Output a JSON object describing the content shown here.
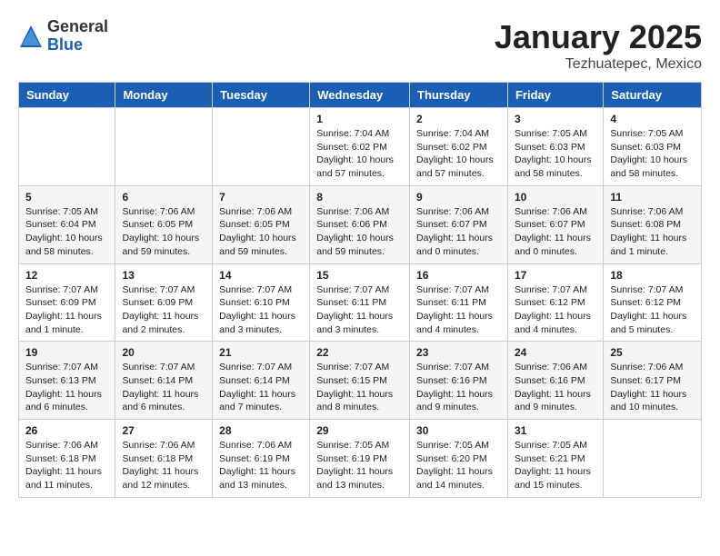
{
  "header": {
    "logo_general": "General",
    "logo_blue": "Blue",
    "month_title": "January 2025",
    "location": "Tezhuatepec, Mexico"
  },
  "weekdays": [
    "Sunday",
    "Monday",
    "Tuesday",
    "Wednesday",
    "Thursday",
    "Friday",
    "Saturday"
  ],
  "weeks": [
    [
      {
        "day": "",
        "info": ""
      },
      {
        "day": "",
        "info": ""
      },
      {
        "day": "",
        "info": ""
      },
      {
        "day": "1",
        "info": "Sunrise: 7:04 AM\nSunset: 6:02 PM\nDaylight: 10 hours\nand 57 minutes."
      },
      {
        "day": "2",
        "info": "Sunrise: 7:04 AM\nSunset: 6:02 PM\nDaylight: 10 hours\nand 57 minutes."
      },
      {
        "day": "3",
        "info": "Sunrise: 7:05 AM\nSunset: 6:03 PM\nDaylight: 10 hours\nand 58 minutes."
      },
      {
        "day": "4",
        "info": "Sunrise: 7:05 AM\nSunset: 6:03 PM\nDaylight: 10 hours\nand 58 minutes."
      }
    ],
    [
      {
        "day": "5",
        "info": "Sunrise: 7:05 AM\nSunset: 6:04 PM\nDaylight: 10 hours\nand 58 minutes."
      },
      {
        "day": "6",
        "info": "Sunrise: 7:06 AM\nSunset: 6:05 PM\nDaylight: 10 hours\nand 59 minutes."
      },
      {
        "day": "7",
        "info": "Sunrise: 7:06 AM\nSunset: 6:05 PM\nDaylight: 10 hours\nand 59 minutes."
      },
      {
        "day": "8",
        "info": "Sunrise: 7:06 AM\nSunset: 6:06 PM\nDaylight: 10 hours\nand 59 minutes."
      },
      {
        "day": "9",
        "info": "Sunrise: 7:06 AM\nSunset: 6:07 PM\nDaylight: 11 hours\nand 0 minutes."
      },
      {
        "day": "10",
        "info": "Sunrise: 7:06 AM\nSunset: 6:07 PM\nDaylight: 11 hours\nand 0 minutes."
      },
      {
        "day": "11",
        "info": "Sunrise: 7:06 AM\nSunset: 6:08 PM\nDaylight: 11 hours\nand 1 minute."
      }
    ],
    [
      {
        "day": "12",
        "info": "Sunrise: 7:07 AM\nSunset: 6:09 PM\nDaylight: 11 hours\nand 1 minute."
      },
      {
        "day": "13",
        "info": "Sunrise: 7:07 AM\nSunset: 6:09 PM\nDaylight: 11 hours\nand 2 minutes."
      },
      {
        "day": "14",
        "info": "Sunrise: 7:07 AM\nSunset: 6:10 PM\nDaylight: 11 hours\nand 3 minutes."
      },
      {
        "day": "15",
        "info": "Sunrise: 7:07 AM\nSunset: 6:11 PM\nDaylight: 11 hours\nand 3 minutes."
      },
      {
        "day": "16",
        "info": "Sunrise: 7:07 AM\nSunset: 6:11 PM\nDaylight: 11 hours\nand 4 minutes."
      },
      {
        "day": "17",
        "info": "Sunrise: 7:07 AM\nSunset: 6:12 PM\nDaylight: 11 hours\nand 4 minutes."
      },
      {
        "day": "18",
        "info": "Sunrise: 7:07 AM\nSunset: 6:12 PM\nDaylight: 11 hours\nand 5 minutes."
      }
    ],
    [
      {
        "day": "19",
        "info": "Sunrise: 7:07 AM\nSunset: 6:13 PM\nDaylight: 11 hours\nand 6 minutes."
      },
      {
        "day": "20",
        "info": "Sunrise: 7:07 AM\nSunset: 6:14 PM\nDaylight: 11 hours\nand 6 minutes."
      },
      {
        "day": "21",
        "info": "Sunrise: 7:07 AM\nSunset: 6:14 PM\nDaylight: 11 hours\nand 7 minutes."
      },
      {
        "day": "22",
        "info": "Sunrise: 7:07 AM\nSunset: 6:15 PM\nDaylight: 11 hours\nand 8 minutes."
      },
      {
        "day": "23",
        "info": "Sunrise: 7:07 AM\nSunset: 6:16 PM\nDaylight: 11 hours\nand 9 minutes."
      },
      {
        "day": "24",
        "info": "Sunrise: 7:06 AM\nSunset: 6:16 PM\nDaylight: 11 hours\nand 9 minutes."
      },
      {
        "day": "25",
        "info": "Sunrise: 7:06 AM\nSunset: 6:17 PM\nDaylight: 11 hours\nand 10 minutes."
      }
    ],
    [
      {
        "day": "26",
        "info": "Sunrise: 7:06 AM\nSunset: 6:18 PM\nDaylight: 11 hours\nand 11 minutes."
      },
      {
        "day": "27",
        "info": "Sunrise: 7:06 AM\nSunset: 6:18 PM\nDaylight: 11 hours\nand 12 minutes."
      },
      {
        "day": "28",
        "info": "Sunrise: 7:06 AM\nSunset: 6:19 PM\nDaylight: 11 hours\nand 13 minutes."
      },
      {
        "day": "29",
        "info": "Sunrise: 7:05 AM\nSunset: 6:19 PM\nDaylight: 11 hours\nand 13 minutes."
      },
      {
        "day": "30",
        "info": "Sunrise: 7:05 AM\nSunset: 6:20 PM\nDaylight: 11 hours\nand 14 minutes."
      },
      {
        "day": "31",
        "info": "Sunrise: 7:05 AM\nSunset: 6:21 PM\nDaylight: 11 hours\nand 15 minutes."
      },
      {
        "day": "",
        "info": ""
      }
    ]
  ]
}
